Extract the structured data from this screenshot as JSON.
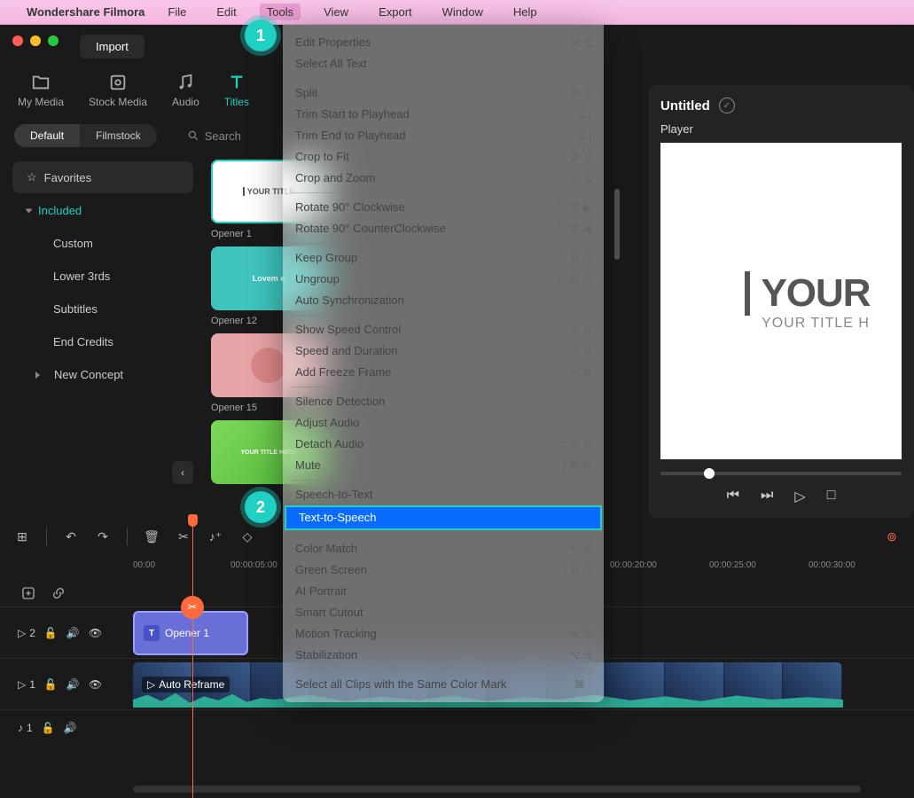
{
  "menubar": {
    "appname": "Wondershare Filmora",
    "items": [
      "File",
      "Edit",
      "Tools",
      "View",
      "Export",
      "Window",
      "Help"
    ],
    "active_index": 2
  },
  "topbar": {
    "import": "Import"
  },
  "tabs": {
    "items": [
      "My Media",
      "Stock Media",
      "Audio",
      "Titles"
    ],
    "active_index": 3
  },
  "subhead": {
    "pill": [
      "Default",
      "Filmstock"
    ],
    "pill_active": 0,
    "search_placeholder": "Search"
  },
  "sidebar": {
    "favorites": "Favorites",
    "included": "Included",
    "items": [
      "Custom",
      "Lower 3rds",
      "Subtitles",
      "End Credits",
      "New Concept"
    ]
  },
  "gallery": {
    "rows": [
      [
        "Opener 1"
      ],
      [
        "Opener 12"
      ],
      [
        "Opener 15"
      ],
      [
        ""
      ]
    ],
    "thumb_text_1": "YOUR TITLE",
    "thumb_text_2": "Lovem e",
    "thumb_text_4": "YOUR TITLE HERE"
  },
  "player": {
    "title": "Untitled",
    "tab": "Player",
    "big": "YOUR",
    "small": "YOUR TITLE H"
  },
  "dropdown": {
    "groups": [
      [
        {
          "label": "Edit Properties",
          "sc": "⌥⌘ E"
        },
        {
          "label": "Select All Text",
          "sc": ""
        }
      ],
      [
        {
          "label": "Split",
          "sc": "⌘ B"
        },
        {
          "label": "Trim Start to Playhead",
          "sc": "⌥ ["
        },
        {
          "label": "Trim End to Playhead",
          "sc": "⌥ ]"
        },
        {
          "label": "Crop to Fit",
          "sc": "⌘ F"
        },
        {
          "label": "Crop and Zoom",
          "sc": "⌥ C"
        }
      ],
      [
        {
          "label": "Rotate 90° Clockwise",
          "sc": "⌥⌘ ▶"
        },
        {
          "label": "Rotate 90° CounterClockwise",
          "sc": "⌥⌘ ◀"
        }
      ],
      [
        {
          "label": "Keep Group",
          "sc": "⌘ G"
        },
        {
          "label": "Ungroup",
          "sc": "⌥⌘ G"
        },
        {
          "label": "Auto Synchronization",
          "sc": ""
        }
      ],
      [
        {
          "label": "Show Speed Control",
          "sc": "⌥ R"
        },
        {
          "label": "Speed and Duration",
          "sc": "⌃ R"
        },
        {
          "label": "Add Freeze Frame",
          "sc": "⌥ F"
        }
      ],
      [
        {
          "label": "Silence Detection",
          "sc": ""
        },
        {
          "label": "Adjust Audio",
          "sc": ""
        },
        {
          "label": "Detach Audio",
          "sc": "⌃⌥ D"
        },
        {
          "label": "Mute",
          "sc": "⇧⌘ M"
        }
      ],
      [
        {
          "label": "Speech-to-Text",
          "sc": ""
        },
        {
          "label": "Text-to-Speech",
          "sc": "",
          "selected": true
        }
      ],
      [
        {
          "label": "Color Match",
          "sc": "⌥ M"
        },
        {
          "label": "Green Screen",
          "sc": "⇧⌘ G"
        },
        {
          "label": "AI Portrait",
          "sc": ""
        },
        {
          "label": "Smart Cutout",
          "sc": ""
        },
        {
          "label": "Motion Tracking",
          "sc": "⌥ X"
        },
        {
          "label": "Stabilization",
          "sc": "⌥ S"
        }
      ],
      [
        {
          "label": "Select all Clips with the Same Color Mark",
          "sc": "⌘ `"
        }
      ]
    ]
  },
  "timeline": {
    "ruler": [
      "00:00",
      "00:00:05:00",
      "",
      "",
      "00:00:20:00",
      "00:00:25:00",
      "00:00:30:00"
    ],
    "tracks": {
      "t2": {
        "label": "2"
      },
      "t1": {
        "label": "1"
      },
      "a1": {
        "label": "1"
      }
    },
    "clip_title": "Opener 1",
    "clip_video": "Auto Reframe"
  },
  "callouts": {
    "c1": "1",
    "c2": "2"
  }
}
